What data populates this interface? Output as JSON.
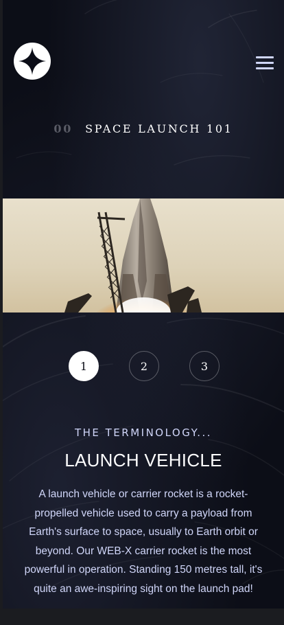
{
  "brand": {
    "logo_icon": "star-logo-icon"
  },
  "nav": {
    "menu_icon": "hamburger-menu-icon"
  },
  "heading": {
    "number": "00",
    "text": "SPACE LAUNCH 101"
  },
  "hero": {
    "image_icon": "rocket-launch-image"
  },
  "steps": [
    {
      "label": "1",
      "active": true
    },
    {
      "label": "2",
      "active": false
    },
    {
      "label": "3",
      "active": false
    }
  ],
  "content": {
    "subtitle": "THE TERMINOLOGY...",
    "title": "LAUNCH VEHICLE",
    "description": "A launch vehicle or carrier rocket is a rocket-propelled vehicle used to carry a payload from Earth's surface to space, usually to Earth orbit or beyond. Our WEB-X carrier rocket is the most powerful in operation. Standing 150 metres tall, it's quite an awe-inspiring sight on the launch pad!"
  },
  "colors": {
    "background": "#0c0e17",
    "accent": "#d0d6f9",
    "white": "#ffffff",
    "muted_number": "#5a5c66"
  }
}
